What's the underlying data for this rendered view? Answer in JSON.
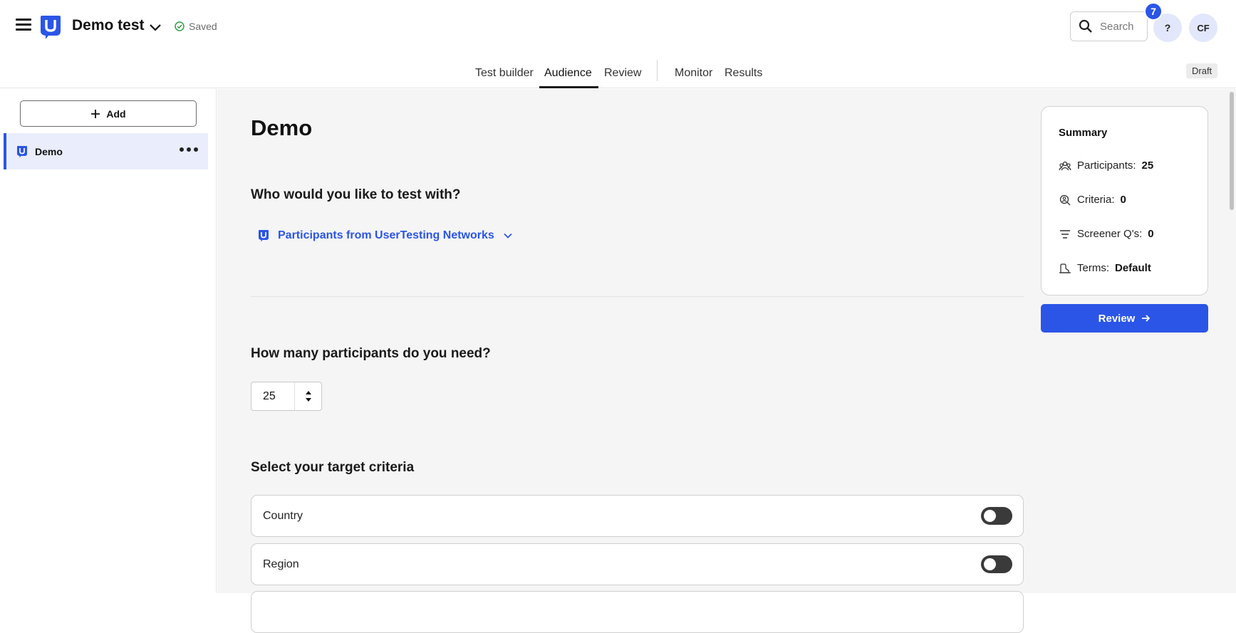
{
  "header": {
    "test_title": "Demo test",
    "save_status": "Saved",
    "search_placeholder": "Search",
    "notification_count": "7",
    "help_label": "?",
    "avatar_initials": "CF",
    "status_badge": "Draft"
  },
  "tabs": [
    {
      "label": "Test builder",
      "active": false
    },
    {
      "label": "Audience",
      "active": true
    },
    {
      "label": "Review",
      "active": false
    },
    {
      "label": "Monitor",
      "active": false
    },
    {
      "label": "Results",
      "active": false
    }
  ],
  "sidebar": {
    "add_label": "Add",
    "items": [
      {
        "label": "Demo",
        "selected": true
      }
    ]
  },
  "main": {
    "title": "Demo",
    "audience_question": "Who would you like to test with?",
    "audience_source": "Participants from UserTesting Networks",
    "participants_question": "How many participants do you need?",
    "participants_value": "25",
    "criteria_heading": "Select your target criteria",
    "criteria": [
      {
        "label": "Country",
        "enabled": false
      },
      {
        "label": "Region",
        "enabled": false
      }
    ]
  },
  "summary": {
    "title": "Summary",
    "rows": [
      {
        "label": "Participants:",
        "value": "25",
        "icon": "participants-icon"
      },
      {
        "label": "Criteria:",
        "value": "0",
        "icon": "criteria-icon"
      },
      {
        "label": "Screener Q's:",
        "value": "0",
        "icon": "screener-icon"
      },
      {
        "label": "Terms:",
        "value": "Default",
        "icon": "terms-icon"
      }
    ],
    "review_button": "Review"
  },
  "colors": {
    "accent": "#2b55e6",
    "selected_bg": "#e9edfc",
    "main_bg": "#f5f5f5"
  }
}
